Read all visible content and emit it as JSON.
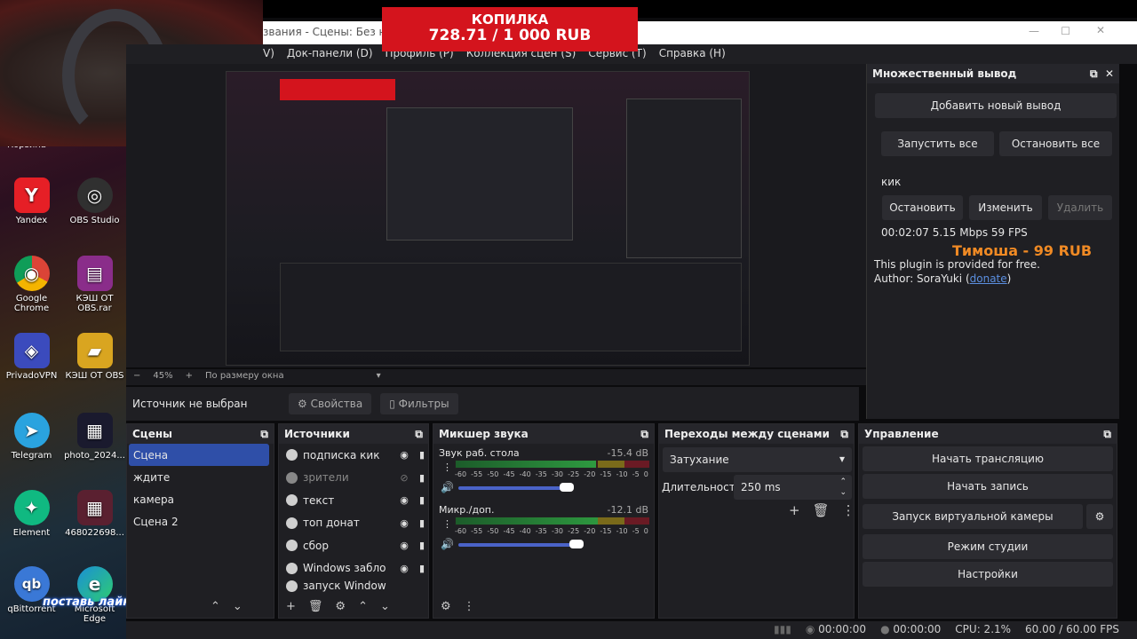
{
  "desktop": {
    "icons": [
      {
        "label": "Yandex",
        "icon": "yandex-icon",
        "color": "#e61f26",
        "glyph": "Y"
      },
      {
        "label": "OBS Studio",
        "icon": "obs-icon",
        "color": "#303030",
        "glyph": "◎"
      },
      {
        "label": "Google Chrome",
        "icon": "chrome-icon",
        "color": "#2b8a3e",
        "glyph": "◉"
      },
      {
        "label": "КЭШ ОТ OBS.rar",
        "icon": "archive-icon",
        "color": "#8a2d8a",
        "glyph": "▤"
      },
      {
        "label": "PrivadoVPN",
        "icon": "vpn-icon",
        "color": "#3b4bbd",
        "glyph": "◈"
      },
      {
        "label": "КЭШ ОТ OBS",
        "icon": "folder-icon",
        "color": "#d9a520",
        "glyph": "▰"
      },
      {
        "label": "Telegram",
        "icon": "telegram-icon",
        "color": "#2aa3df",
        "glyph": "➤"
      },
      {
        "label": "photo_2024...",
        "icon": "image-file-icon",
        "color": "#1a1a2e",
        "glyph": "▦"
      },
      {
        "label": "Element",
        "icon": "element-icon",
        "color": "#10b981",
        "glyph": "✦"
      },
      {
        "label": "468022698...",
        "icon": "image-file-icon",
        "color": "#5a2030",
        "glyph": "▦"
      },
      {
        "label": "qBittorrent",
        "icon": "qbittorrent-icon",
        "color": "#3a78d6",
        "glyph": "qb"
      },
      {
        "label": "Microsoft Edge",
        "icon": "edge-icon",
        "color": "#1a8fd6",
        "glyph": "e"
      }
    ],
    "top_truncated": "Корзина"
  },
  "window": {
    "title": "звания - Сцены: Без назва",
    "menu": [
      "V)",
      "Док-панели (D)",
      "Профиль (P)",
      "Коллекция сцен (S)",
      "Сервис (T)",
      "Справка (H)"
    ]
  },
  "donation": {
    "title": "КОПИЛКА",
    "amount": "728.71 / 1 000 RUB"
  },
  "preview": {
    "zoom": "45%",
    "zoom_minus": "−",
    "zoom_plus": "+",
    "fit": "По размеру окна",
    "overlay_text": "поставь лайк пожалуйста"
  },
  "source_bar": {
    "no_source": "Источник не выбран",
    "properties": "Свойства",
    "filters": "Фильтры"
  },
  "multi_output": {
    "title": "Множественный вывод",
    "add": "Добавить новый вывод",
    "start_all": "Запустить все",
    "stop_all": "Остановить все",
    "target": "кик",
    "stop": "Остановить",
    "edit": "Изменить",
    "delete": "Удалить",
    "stats": "00:02:07  5.15 Mbps  59 FPS",
    "donor_alert": "Тимоша - 99 RUB",
    "free_note": "This plugin is provided for free.",
    "author_prefix": "Author: SoraYuki (",
    "donate": "donate",
    "author_suffix": ")"
  },
  "scenes": {
    "title": "Сцены",
    "items": [
      "Сцена",
      "ждите",
      "камера",
      "Сцена 2"
    ]
  },
  "sources": {
    "title": "Источники",
    "items": [
      "подписка кик",
      "зрители",
      "текст",
      "топ донат",
      "сбор",
      "Windows забло",
      "запуск Window"
    ]
  },
  "mixer": {
    "title": "Микшер звука",
    "tracks": [
      {
        "name": "Звук раб. стола",
        "db": "-15.4 dB",
        "level": 0.83,
        "volume": 0.87
      },
      {
        "name": "Микр./доп.",
        "db": "-12.1 dB",
        "level": 0.89,
        "volume": 0.95
      }
    ],
    "scale": [
      "-60",
      "-55",
      "-50",
      "-45",
      "-40",
      "-35",
      "-30",
      "-25",
      "-20",
      "-15",
      "-10",
      "-5",
      "0"
    ]
  },
  "transitions": {
    "title": "Переходы между сценами",
    "selected": "Затухание",
    "duration_label": "Длительность",
    "duration": "250 ms"
  },
  "controls": {
    "title": "Управление",
    "buttons": [
      "Начать трансляцию",
      "Начать запись",
      "Запуск виртуальной камеры",
      "Режим студии",
      "Настройки"
    ]
  },
  "status": {
    "stream_time": "00:00:00",
    "rec_time": "00:00:00",
    "cpu": "CPU: 2.1%",
    "fps": "60.00 / 60.00 FPS"
  },
  "colors": {
    "accent": "#2f4fa8",
    "donation": "#d4141d",
    "alert": "#f08a24",
    "link": "#5b8fe0"
  }
}
